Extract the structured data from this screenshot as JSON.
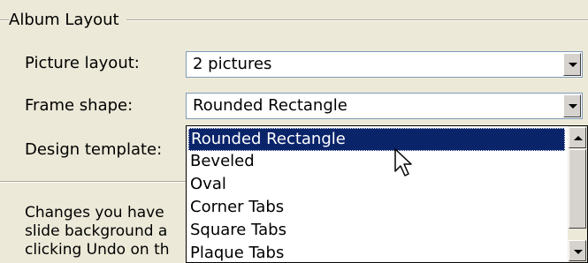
{
  "group": {
    "title": "Album Layout"
  },
  "fields": {
    "picture_layout": {
      "label": "Picture layout:",
      "value": "2 pictures"
    },
    "frame_shape": {
      "label": "Frame shape:",
      "value": "Rounded Rectangle"
    },
    "design_template": {
      "label": "Design template:"
    }
  },
  "frame_shape_dropdown": {
    "selected": "Rounded Rectangle",
    "options": [
      "Rounded Rectangle",
      "Beveled",
      "Oval",
      "Corner Tabs",
      "Square Tabs",
      "Plaque Tabs"
    ]
  },
  "description": {
    "lines": [
      "Changes you have",
      "slide background a",
      "clicking Undo on th"
    ]
  },
  "colors": {
    "dialog_bg": "#ece9d8",
    "selection_bg": "#0a246a",
    "field_border": "#7f9db9"
  },
  "icons": [
    "chevron-down-icon",
    "scroll-up-icon",
    "scroll-down-icon",
    "mouse-pointer-icon"
  ]
}
